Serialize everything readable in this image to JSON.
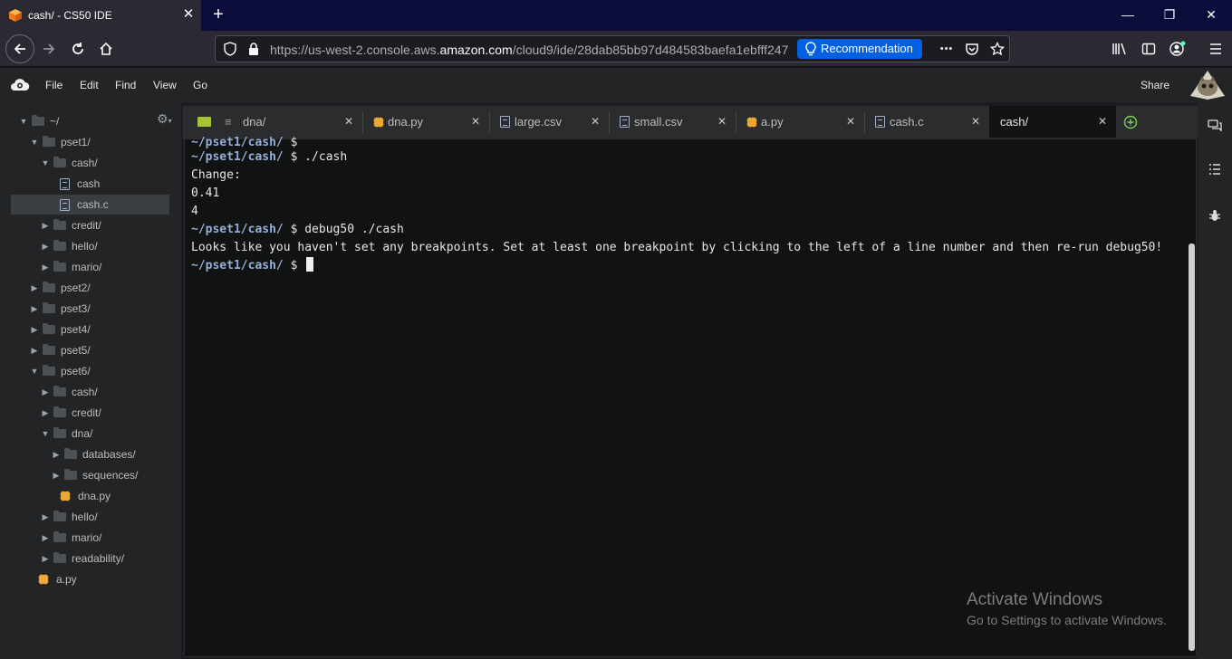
{
  "browser": {
    "tab_title": "cash/ - CS50 IDE",
    "tab_close": "✕",
    "new_tab": "+",
    "url_prefix": "https://us-west-2.console.aws.",
    "url_domain": "amazon.com",
    "url_path": "/cloud9/ide/28dab85bb97d484583baefa1ebfff247",
    "recommendation_label": "Recommendation",
    "more_label": "•••",
    "win_minimize": "—",
    "win_restore": "❐",
    "win_close": "✕"
  },
  "ide": {
    "menu": [
      "File",
      "Edit",
      "Find",
      "View",
      "Go"
    ],
    "share_label": "Share",
    "tree": [
      {
        "label": "~/",
        "depth": 0,
        "kind": "folder",
        "open": true
      },
      {
        "label": "pset1/",
        "depth": 1,
        "kind": "folder",
        "open": true
      },
      {
        "label": "cash/",
        "depth": 2,
        "kind": "folder",
        "open": true
      },
      {
        "label": "cash",
        "depth": 3,
        "kind": "file"
      },
      {
        "label": "cash.c",
        "depth": 3,
        "kind": "file",
        "selected": true
      },
      {
        "label": "credit/",
        "depth": 2,
        "kind": "folder",
        "open": false
      },
      {
        "label": "hello/",
        "depth": 2,
        "kind": "folder",
        "open": false
      },
      {
        "label": "mario/",
        "depth": 2,
        "kind": "folder",
        "open": false
      },
      {
        "label": "pset2/",
        "depth": 1,
        "kind": "folder",
        "open": false
      },
      {
        "label": "pset3/",
        "depth": 1,
        "kind": "folder",
        "open": false
      },
      {
        "label": "pset4/",
        "depth": 1,
        "kind": "folder",
        "open": false
      },
      {
        "label": "pset5/",
        "depth": 1,
        "kind": "folder",
        "open": false
      },
      {
        "label": "pset6/",
        "depth": 1,
        "kind": "folder",
        "open": true
      },
      {
        "label": "cash/",
        "depth": 2,
        "kind": "folder",
        "open": false
      },
      {
        "label": "credit/",
        "depth": 2,
        "kind": "folder",
        "open": false
      },
      {
        "label": "dna/",
        "depth": 2,
        "kind": "folder",
        "open": true
      },
      {
        "label": "databases/",
        "depth": 3,
        "kind": "folder",
        "open": false
      },
      {
        "label": "sequences/",
        "depth": 3,
        "kind": "folder",
        "open": false
      },
      {
        "label": "dna.py",
        "depth": 3,
        "kind": "py"
      },
      {
        "label": "hello/",
        "depth": 2,
        "kind": "folder",
        "open": false
      },
      {
        "label": "mario/",
        "depth": 2,
        "kind": "folder",
        "open": false
      },
      {
        "label": "readability/",
        "depth": 2,
        "kind": "folder",
        "open": false
      },
      {
        "label": "a.py",
        "depth": 1,
        "kind": "py"
      }
    ],
    "tabs": [
      {
        "label": "dna/",
        "icon": "folder"
      },
      {
        "label": "dna.py",
        "icon": "py"
      },
      {
        "label": "large.csv",
        "icon": "file"
      },
      {
        "label": "small.csv",
        "icon": "file"
      },
      {
        "label": "a.py",
        "icon": "py"
      },
      {
        "label": "cash.c",
        "icon": "file"
      },
      {
        "label": "cash/",
        "icon": "none",
        "active": true
      }
    ],
    "tab_close": "✕",
    "terminal": [
      {
        "prompt": "~/pset1/cash/",
        "cmd": " $ "
      },
      {
        "prompt": "~/pset1/cash/",
        "cmd": " $ ./cash"
      },
      {
        "prompt": "",
        "cmd": "Change:"
      },
      {
        "prompt": "",
        "cmd": "0.41"
      },
      {
        "prompt": "",
        "cmd": "4"
      },
      {
        "prompt": "~/pset1/cash/",
        "cmd": " $ debug50 ./cash"
      },
      {
        "prompt": "",
        "cmd": "Looks like you haven't set any breakpoints. Set at least one breakpoint by clicking to the left of a line number and then re-run debug50!"
      },
      {
        "prompt": "~/pset1/cash/",
        "cmd": " $ "
      }
    ]
  },
  "watermark": {
    "line1": "Activate Windows",
    "line2": "Go to Settings to activate Windows."
  },
  "colors": {
    "accent": "#0060df",
    "prompt": "#94b0d8",
    "python_icon": "#f0a732"
  }
}
